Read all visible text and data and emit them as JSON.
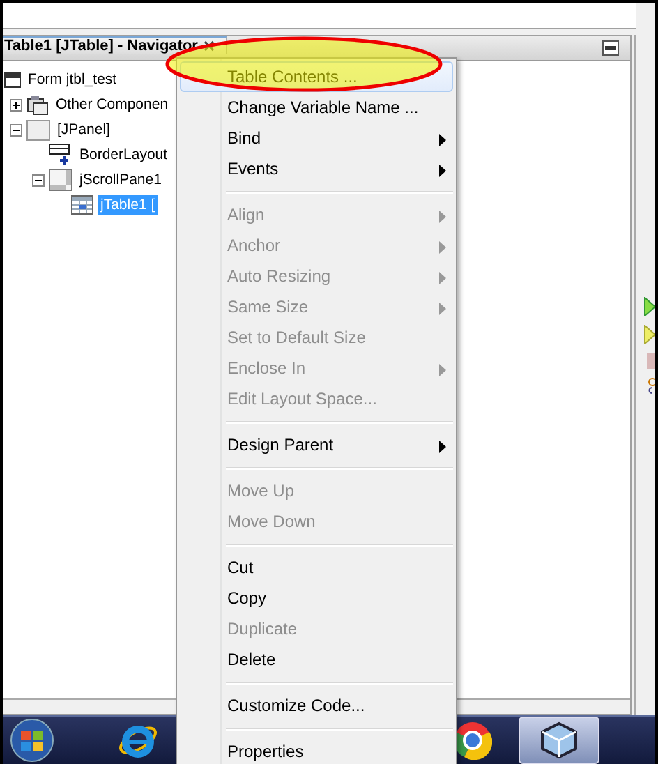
{
  "navigator": {
    "title": "Table1 [JTable] - Navigator"
  },
  "tree": [
    {
      "label": "Form jtbl_test",
      "kind": "form",
      "selected": false,
      "children": [
        {
          "label": "Other Componen",
          "kind": "components",
          "expanded": false,
          "selected": false
        },
        {
          "label": "[JPanel]",
          "kind": "panel",
          "expanded": true,
          "selected": false,
          "children": [
            {
              "label": "BorderLayout",
              "kind": "layout",
              "selected": false
            },
            {
              "label": "jScrollPane1",
              "kind": "scrollpane",
              "expanded": true,
              "selected": false,
              "children": [
                {
                  "label": "jTable1 [",
                  "kind": "table",
                  "selected": true
                }
              ]
            }
          ]
        }
      ]
    }
  ],
  "context_menu": {
    "items": [
      {
        "kind": "item",
        "label": "Table Contents ...",
        "disabled": false,
        "submenu": false,
        "selected": true
      },
      {
        "kind": "item",
        "label": "Change Variable Name ...",
        "disabled": false,
        "submenu": false,
        "selected": false
      },
      {
        "kind": "item",
        "label": "Bind",
        "disabled": false,
        "submenu": true,
        "selected": false
      },
      {
        "kind": "item",
        "label": "Events",
        "disabled": false,
        "submenu": true,
        "selected": false
      },
      {
        "kind": "separator"
      },
      {
        "kind": "item",
        "label": "Align",
        "disabled": true,
        "submenu": true,
        "selected": false
      },
      {
        "kind": "item",
        "label": "Anchor",
        "disabled": true,
        "submenu": true,
        "selected": false
      },
      {
        "kind": "item",
        "label": "Auto Resizing",
        "disabled": true,
        "submenu": true,
        "selected": false
      },
      {
        "kind": "item",
        "label": "Same Size",
        "disabled": true,
        "submenu": true,
        "selected": false
      },
      {
        "kind": "item",
        "label": "Set to Default Size",
        "disabled": true,
        "submenu": false,
        "selected": false
      },
      {
        "kind": "item",
        "label": "Enclose In",
        "disabled": true,
        "submenu": true,
        "selected": false
      },
      {
        "kind": "item",
        "label": "Edit Layout Space...",
        "disabled": true,
        "submenu": false,
        "selected": false
      },
      {
        "kind": "separator"
      },
      {
        "kind": "item",
        "label": "Design Parent",
        "disabled": false,
        "submenu": true,
        "selected": false
      },
      {
        "kind": "separator"
      },
      {
        "kind": "item",
        "label": "Move Up",
        "disabled": true,
        "submenu": false,
        "selected": false
      },
      {
        "kind": "item",
        "label": "Move Down",
        "disabled": true,
        "submenu": false,
        "selected": false
      },
      {
        "kind": "separator"
      },
      {
        "kind": "item",
        "label": "Cut",
        "disabled": false,
        "submenu": false,
        "selected": false
      },
      {
        "kind": "item",
        "label": "Copy",
        "disabled": false,
        "submenu": false,
        "selected": false
      },
      {
        "kind": "item",
        "label": "Duplicate",
        "disabled": true,
        "submenu": false,
        "selected": false
      },
      {
        "kind": "item",
        "label": "Delete",
        "disabled": false,
        "submenu": false,
        "selected": false
      },
      {
        "kind": "separator"
      },
      {
        "kind": "item",
        "label": "Customize Code...",
        "disabled": false,
        "submenu": false,
        "selected": false
      },
      {
        "kind": "separator"
      },
      {
        "kind": "item",
        "label": "Properties",
        "disabled": false,
        "submenu": false,
        "selected": false
      }
    ]
  },
  "taskbar": {
    "apps": [
      {
        "kind": "start",
        "selected": false
      },
      {
        "kind": "browser-e",
        "selected": false
      },
      {
        "kind": "browser-ring",
        "selected": false
      },
      {
        "kind": "cube",
        "selected": true
      }
    ]
  }
}
